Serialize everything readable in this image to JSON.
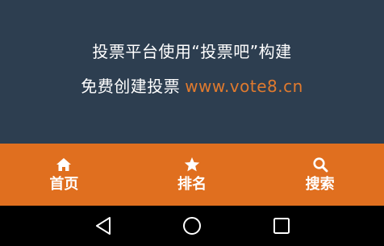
{
  "footer": {
    "line1": "投票平台使用“投票吧”构建",
    "line2_prefix": "免费创建投票",
    "line2_link": "www.vote8.cn"
  },
  "tabbar": {
    "tabs": [
      {
        "label": "首页",
        "icon": "home-icon"
      },
      {
        "label": "排名",
        "icon": "star-icon"
      },
      {
        "label": "搜索",
        "icon": "search-icon"
      }
    ]
  },
  "system_nav": {
    "buttons": [
      "back",
      "home",
      "recent-apps"
    ]
  },
  "colors": {
    "background": "#2d3e50",
    "tabbar": "#e06f1f",
    "link": "#e07a2e",
    "system_nav": "#000000"
  }
}
